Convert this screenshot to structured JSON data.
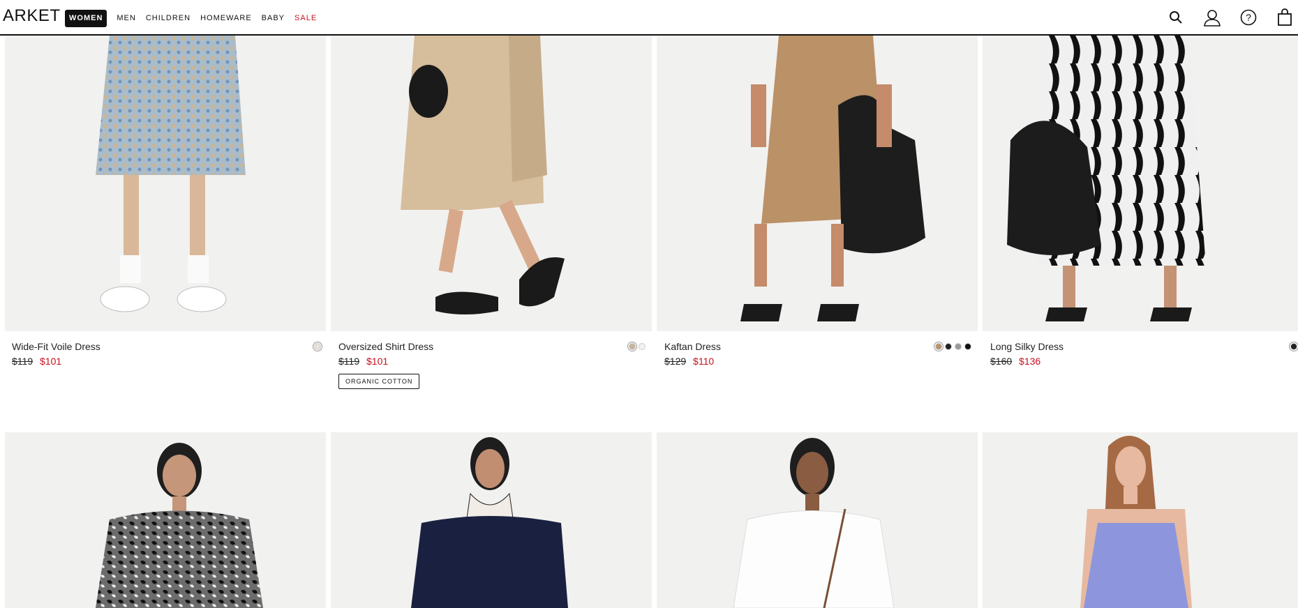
{
  "header": {
    "logo": "ARKET",
    "nav": [
      {
        "label": "WOMEN",
        "active": true
      },
      {
        "label": "MEN"
      },
      {
        "label": "CHILDREN"
      },
      {
        "label": "HOMEWARE"
      },
      {
        "label": "BABY"
      },
      {
        "label": "SALE",
        "sale": true
      }
    ],
    "icons": [
      "search-icon",
      "account-icon",
      "help-icon",
      "bag-icon"
    ]
  },
  "products": [
    {
      "name": "Wide-Fit Voile Dress",
      "old_price": "$119",
      "new_price": "$101",
      "swatches": [
        "#e8e4dc"
      ],
      "tag": ""
    },
    {
      "name": "Oversized Shirt Dress",
      "old_price": "$119",
      "new_price": "$101",
      "swatches": [
        "#c9b49a",
        "#f2f2f2"
      ],
      "tag": "ORGANIC COTTON"
    },
    {
      "name": "Kaftan Dress",
      "old_price": "$129",
      "new_price": "$110",
      "swatches": [
        "#b8956f",
        "#222222",
        "#9a9a9a",
        "#111111"
      ],
      "tag": ""
    },
    {
      "name": "Long Silky Dress",
      "old_price": "$160",
      "new_price": "$136",
      "swatches": [
        "#222222"
      ],
      "tag": ""
    }
  ],
  "colors": {
    "accent": "#111111",
    "sale": "#c8101f",
    "image_bg": "#f2f2f2"
  }
}
